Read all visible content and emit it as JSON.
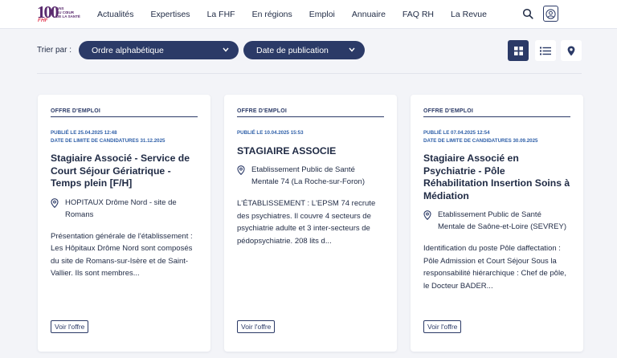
{
  "header": {
    "logo": {
      "number": "100",
      "lines": [
        "ANS",
        "AU CŒUR",
        "DE LA SANTÉ"
      ],
      "brand": "FHF"
    },
    "nav": [
      "Actualités",
      "Expertises",
      "La FHF",
      "En régions",
      "Emploi",
      "Annuaire",
      "FAQ RH",
      "La Revue"
    ]
  },
  "toolbar": {
    "sort_label": "Trier par :",
    "sort_options": [
      "Ordre alphabétique",
      "Date de publication"
    ],
    "views": [
      "grid-view-icon",
      "list-view-icon",
      "map-pin-icon"
    ]
  },
  "colors": {
    "primary": "#2b3a67",
    "accent_blue": "#2e5fa8",
    "background": "#f3f4f8",
    "logo_purple": "#5a2a6e",
    "logo_red": "#e23a52"
  },
  "cards": [
    {
      "tag": "OFFRE D'EMPLOI",
      "published": "PUBLIÉ LE 25.04.2025 12:48",
      "deadline": "DATE DE LIMITE DE CANDIDATURES 31.12.2025",
      "title": "Stagiaire Associé - Service de Court Séjour Gériatrique - Temps plein [F/H]",
      "location": "HOPITAUX Drôme Nord - site de Romans",
      "description": "Présentation générale de l'établissement : Les Hôpitaux Drôme Nord sont composés du site de Romans-sur-Isère et de Saint-Vallier. Ils sont membres...",
      "button": "Voir l'offre"
    },
    {
      "tag": "OFFRE D'EMPLOI",
      "published": "PUBLIÉ LE 10.04.2025 15:53",
      "deadline": "",
      "title": "STAGIAIRE ASSOCIE",
      "location": "Etablissement Public de Santé Mentale 74 (La Roche-sur-Foron)",
      "description": "L'ÉTABLISSEMENT : L'EPSM 74 recrute des psychiatres. Il couvre 4 secteurs de psychiatrie adulte et 3 inter-secteurs de pédopsychiatrie. 208 lits d...",
      "button": "Voir l'offre"
    },
    {
      "tag": "OFFRE D'EMPLOI",
      "published": "PUBLIÉ LE 07.04.2025 12:54",
      "deadline": "DATE DE LIMITE DE CANDIDATURES 30.09.2025",
      "title": "Stagiaire Associé en Psychiatrie - Pôle Réhabilitation Insertion Soins à Médiation",
      "location": "Etablissement Public de Santé Mentale de Saône-et-Loire (SEVREY)",
      "description": "Identification du poste Pôle daffectation : Pôle Admission et Court Séjour Sous la responsabilité hiérarchique : Chef de pôle, le Docteur BADER...",
      "button": "Voir l'offre"
    }
  ]
}
